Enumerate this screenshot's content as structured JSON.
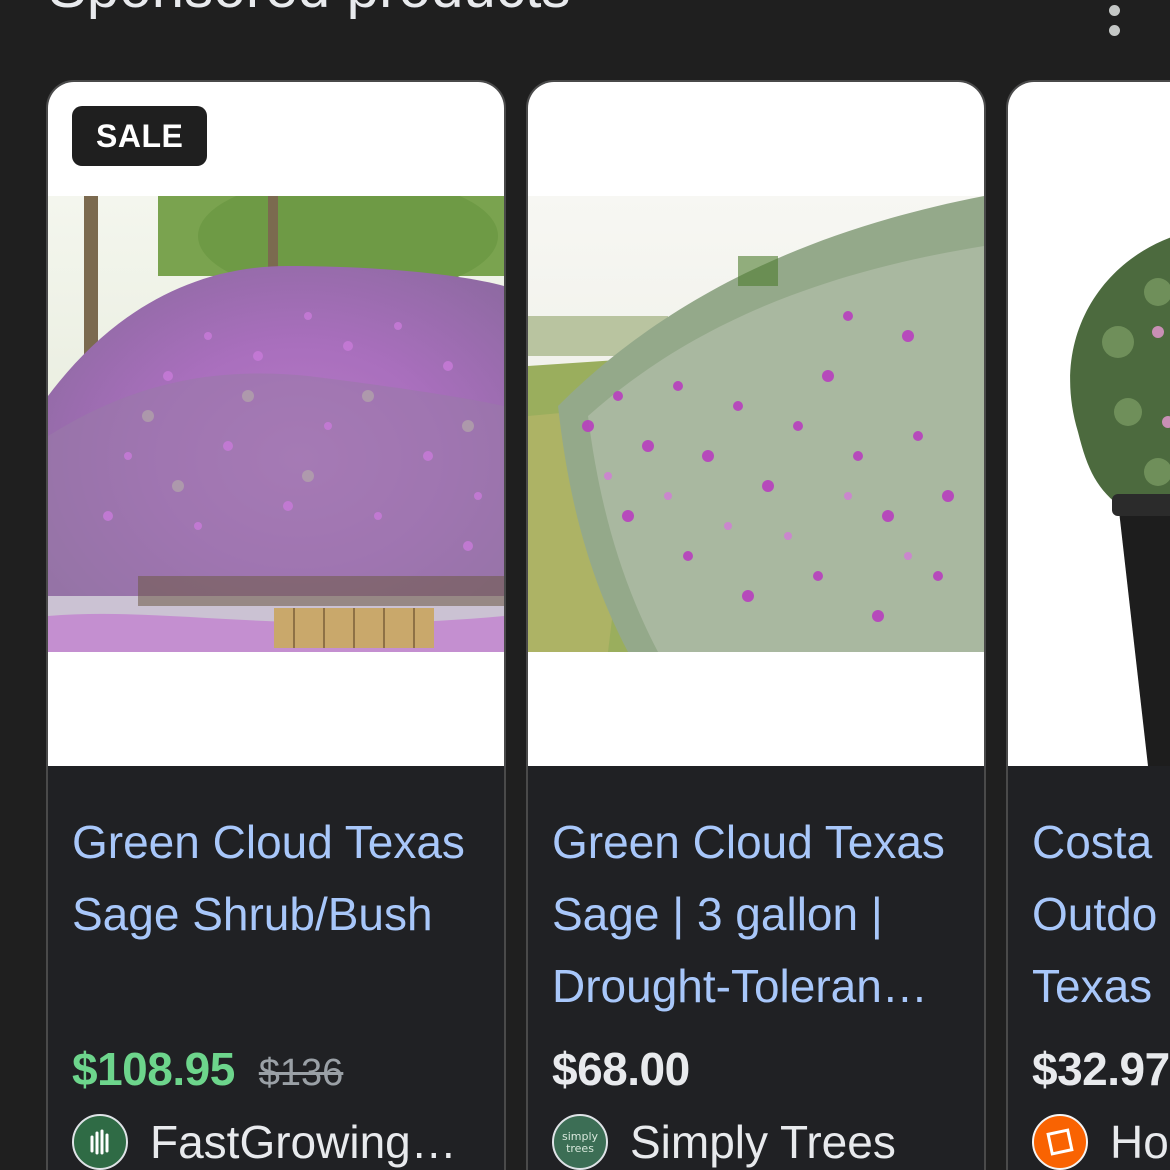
{
  "section": {
    "title": "Sponsored products",
    "menu_icon": "more-vert-icon"
  },
  "products": [
    {
      "badge": "SALE",
      "title_lines": [
        "Green Cloud Texas",
        "Sage Shrub/Bush",
        ""
      ],
      "price": "$108.95",
      "old_price": "$136",
      "merchant": "FastGrowing…",
      "price_color": "#6dd58c"
    },
    {
      "badge": "",
      "title_lines": [
        "Green Cloud Texas",
        "Sage | 3 gallon |",
        "Drought-Toleran…"
      ],
      "price": "$68.00",
      "old_price": "",
      "merchant": "Simply Trees",
      "merchant_logo_text": "simply trees"
    },
    {
      "badge": "",
      "title_lines": [
        "Costa",
        "Outdo",
        "Texas"
      ],
      "price": "$32.97",
      "old_price": "",
      "merchant": "Ho"
    }
  ],
  "colors": {
    "background": "#1f1f1f",
    "link_blue": "#a8c7fa",
    "sale_green": "#6dd58c",
    "text": "#e8eaed",
    "card_border": "#4a4a4a"
  }
}
